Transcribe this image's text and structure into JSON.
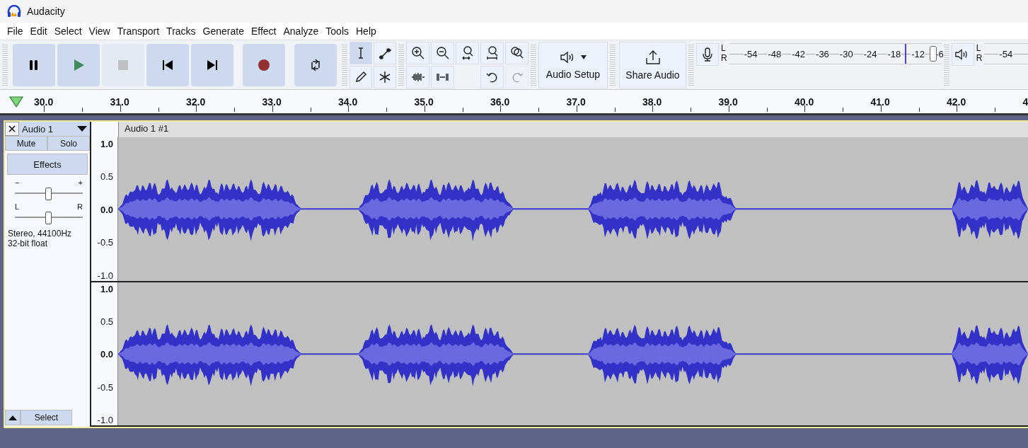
{
  "window": {
    "title": "Audacity"
  },
  "menu": [
    "File",
    "Edit",
    "Select",
    "View",
    "Transport",
    "Tracks",
    "Generate",
    "Effect",
    "Analyze",
    "Tools",
    "Help"
  ],
  "transport": [
    {
      "kind": "pause",
      "disabled": false
    },
    {
      "kind": "play",
      "disabled": false
    },
    {
      "kind": "stop",
      "disabled": true
    },
    {
      "kind": "skip-start",
      "disabled": false
    },
    {
      "kind": "skip-end",
      "disabled": false
    },
    {
      "kind": "record",
      "disabled": false
    },
    {
      "kind": "loop",
      "disabled": false
    }
  ],
  "tools": [
    {
      "kind": "select",
      "selected": true
    },
    {
      "kind": "envelope",
      "selected": false
    },
    {
      "kind": "draw",
      "selected": false
    },
    {
      "kind": "multi",
      "selected": false
    }
  ],
  "edit_tools": [
    {
      "kind": "zoom-in",
      "disabled": false
    },
    {
      "kind": "zoom-out",
      "disabled": false
    },
    {
      "kind": "fit-selection",
      "disabled": false
    },
    {
      "kind": "fit-project",
      "disabled": false
    },
    {
      "kind": "zoom-toggle",
      "disabled": false
    },
    {
      "kind": "trim",
      "disabled": false
    },
    {
      "kind": "silence",
      "disabled": false
    },
    {
      "kind": "undo",
      "disabled": false
    },
    {
      "kind": "redo",
      "disabled": true
    }
  ],
  "audio_setup": {
    "label": "Audio Setup"
  },
  "share_audio": {
    "label": "Share Audio"
  },
  "record_meter": {
    "channels": [
      "L",
      "R"
    ],
    "ticks": [
      "-54",
      "-48",
      "-42",
      "-36",
      "-30",
      "-24",
      "-18",
      "-12",
      "-6"
    ]
  },
  "playback_meter": {
    "channels": [
      "L",
      "R"
    ],
    "ticks": [
      "-54"
    ]
  },
  "timeline": {
    "ticks": [
      "30.0",
      "31.0",
      "32.0",
      "33.0",
      "34.0",
      "35.0",
      "36.0",
      "37.0",
      "38.0",
      "39.0",
      "40.0",
      "41.0",
      "42.0",
      "4"
    ]
  },
  "track": {
    "name": "Audio 1",
    "clip_name": "Audio 1 #1",
    "mute": "Mute",
    "solo": "Solo",
    "effects": "Effects",
    "gain": {
      "minus": "−",
      "plus": "+",
      "level": 0.5
    },
    "pan": {
      "left": "L",
      "right": "R",
      "level": 0.5
    },
    "info": [
      "Stereo, 44100Hz",
      "32-bit float"
    ],
    "select": "Select",
    "channels": [
      {
        "scale": [
          "1.0",
          "0.5",
          "0.0",
          "-0.5",
          "-1.0"
        ]
      },
      {
        "scale": [
          "1.0",
          "0.5",
          "0.0",
          "-0.5",
          "-1.0"
        ]
      }
    ]
  }
}
